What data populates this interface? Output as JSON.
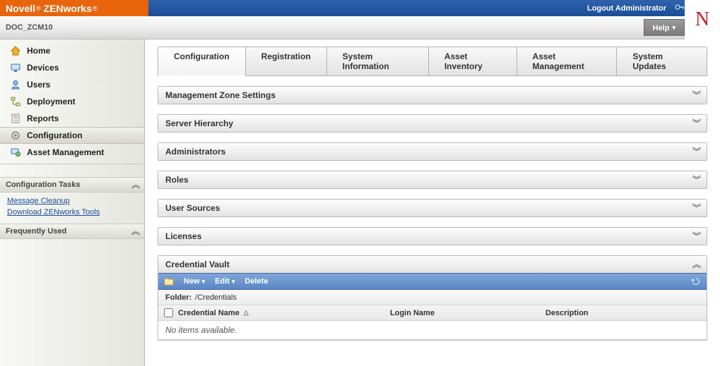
{
  "brand": {
    "vendor": "Novell",
    "product": "ZENworks"
  },
  "banner": {
    "logout_label": "Logout Administrator"
  },
  "context": {
    "name": "DOC_ZCM10",
    "help_label": "Help"
  },
  "logo": {
    "letter": "N"
  },
  "nav": {
    "items": [
      {
        "label": "Home"
      },
      {
        "label": "Devices"
      },
      {
        "label": "Users"
      },
      {
        "label": "Deployment"
      },
      {
        "label": "Reports"
      },
      {
        "label": "Configuration"
      },
      {
        "label": "Asset Management"
      }
    ]
  },
  "side_sections": {
    "tasks_title": "Configuration Tasks",
    "tasks_links": [
      "Message Cleanup",
      "Download ZENworks Tools"
    ],
    "freq_title": "Frequently Used"
  },
  "tabs": [
    "Configuration",
    "Registration",
    "System Information",
    "Asset Inventory",
    "Asset Management",
    "System Updates"
  ],
  "panels": {
    "mzs": "Management Zone Settings",
    "sh": "Server Hierarchy",
    "adm": "Administrators",
    "rol": "Roles",
    "us": "User Sources",
    "lic": "Licenses",
    "cv": "Credential Vault"
  },
  "credential_vault": {
    "action_new": "New",
    "action_edit": "Edit",
    "action_delete": "Delete",
    "folder_label": "Folder:",
    "folder_path": "/Credentials",
    "columns": {
      "name": "Credential Name",
      "login": "Login Name",
      "desc": "Description"
    },
    "empty": "No items available."
  }
}
